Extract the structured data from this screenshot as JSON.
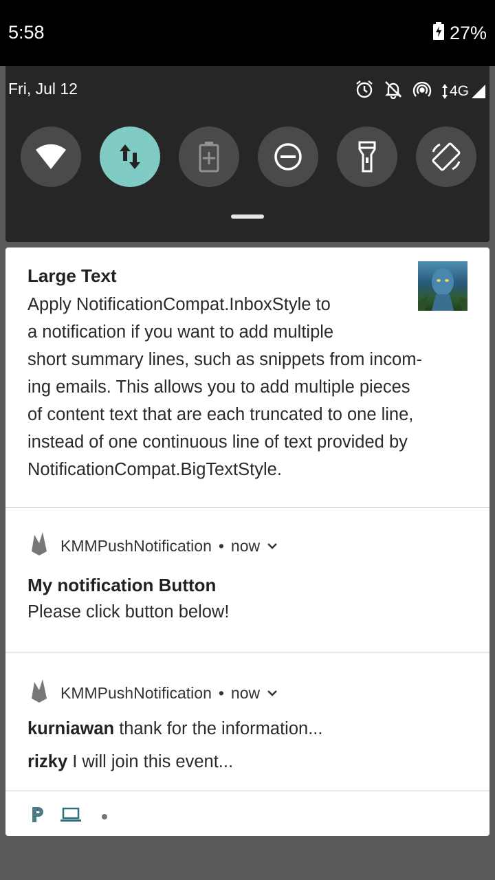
{
  "status_bar": {
    "time": "5:58",
    "battery": "27%"
  },
  "quick_settings": {
    "date": "Fri, Jul 12",
    "network": "4G",
    "tiles": [
      {
        "name": "wifi",
        "active": false
      },
      {
        "name": "mobile-data",
        "active": true
      },
      {
        "name": "battery-saver",
        "active": false
      },
      {
        "name": "do-not-disturb",
        "active": false
      },
      {
        "name": "flashlight",
        "active": false
      },
      {
        "name": "auto-rotate",
        "active": false
      }
    ]
  },
  "notifications": [
    {
      "title": "Large Text",
      "body": "Apply NotificationCompat.InboxStyle to\na notification if you want to add multiple\nshort summary lines, such as snippets from incom-\ning emails. This allows you to add multiple pieces\nof content text that are each truncated to one line,\ninstead of one continuous line of text provided by\nNotificationCompat.BigTextStyle."
    },
    {
      "app": "KMMPushNotification",
      "separator": "•",
      "time": "now",
      "title": "My notification Button",
      "text": "Please click button below!"
    },
    {
      "app": "KMMPushNotification",
      "separator": "•",
      "time": "now",
      "messages": [
        {
          "sender": "kurniawan",
          "text": "thank for the information..."
        },
        {
          "sender": "rizky",
          "text": "I will join this event..."
        }
      ]
    }
  ],
  "colors": {
    "accent_tile": "#80cbc4",
    "panel": "#262626",
    "icon_teal": "#4a7a86"
  }
}
